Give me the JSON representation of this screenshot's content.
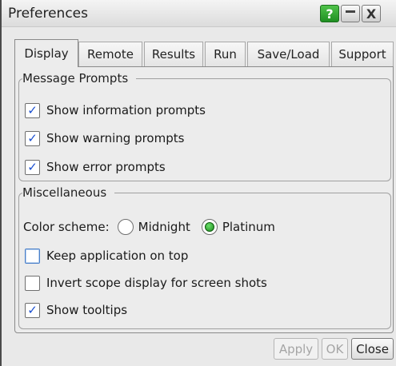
{
  "window": {
    "title": "Preferences",
    "help_label": "?",
    "close_label": "X"
  },
  "tabs": [
    {
      "label": "Display",
      "active": true
    },
    {
      "label": "Remote",
      "active": false
    },
    {
      "label": "Results",
      "active": false
    },
    {
      "label": "Run",
      "active": false
    },
    {
      "label": "Save/Load",
      "active": false
    },
    {
      "label": "Support",
      "active": false
    }
  ],
  "message_prompts": {
    "legend": "Message Prompts",
    "items": [
      {
        "label": "Show information prompts",
        "checked": true
      },
      {
        "label": "Show warning prompts",
        "checked": true
      },
      {
        "label": "Show error prompts",
        "checked": true
      }
    ]
  },
  "miscellaneous": {
    "legend": "Miscellaneous",
    "color_scheme_label": "Color scheme:",
    "color_scheme_options": [
      {
        "label": "Midnight",
        "selected": false
      },
      {
        "label": "Platinum",
        "selected": true
      }
    ],
    "items": [
      {
        "label": "Keep application on top",
        "checked": false
      },
      {
        "label": "Invert scope display for screen shots",
        "checked": false
      },
      {
        "label": "Show tooltips",
        "checked": true
      }
    ]
  },
  "footer": {
    "apply_label": "Apply",
    "ok_label": "OK",
    "close_label": "Close"
  },
  "check_glyph": "✓"
}
